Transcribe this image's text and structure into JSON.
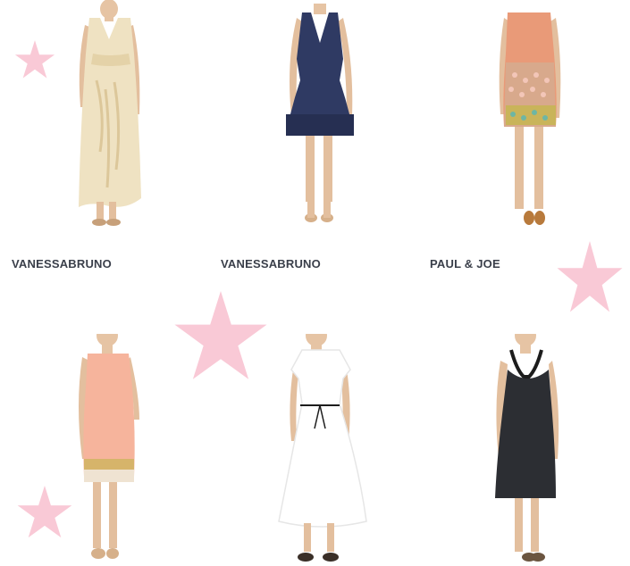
{
  "products": [
    {
      "brand": "VANESSABRUNO",
      "image": "cream-embroidered-maxi-dress"
    },
    {
      "brand": "VANESSABRUNO",
      "image": "navy-v-neck-flared-dress"
    },
    {
      "brand": "PAUL & JOE",
      "image": "coral-heart-print-shift-dress"
    },
    {
      "brand": "",
      "image": "peach-sequin-hem-dress"
    },
    {
      "brand": "",
      "image": "white-drawstring-midi-dress"
    },
    {
      "brand": "",
      "image": "black-halter-dress"
    }
  ],
  "colors": {
    "star": "#f9c9d6",
    "brand_text": "#3a3f4a"
  },
  "decorations": [
    "star-icon",
    "star-icon",
    "star-icon",
    "star-icon",
    "star-icon"
  ]
}
